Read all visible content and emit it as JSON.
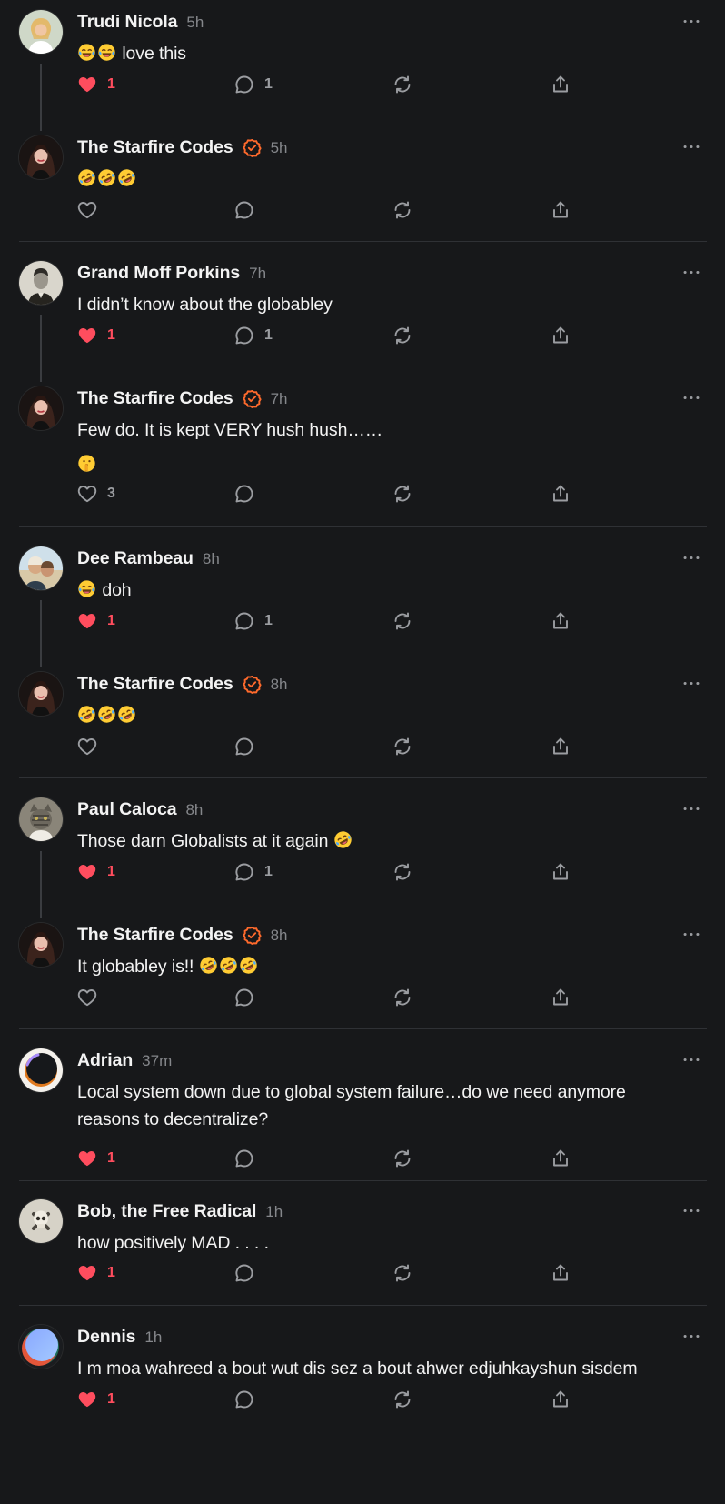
{
  "colors": {
    "background": "#17181a",
    "like_active": "#ff4d5e",
    "verified": "#ff6a2c",
    "muted": "#85878b",
    "icon": "#9b9da1"
  },
  "posts": [
    {
      "author": "Trudi Nicola",
      "time": "5h",
      "verified": false,
      "lines": [
        [
          {
            "emoji": "laughing-tears"
          },
          {
            "emoji": "laughing-tears"
          },
          {
            "t": " love this"
          }
        ]
      ],
      "liked": true,
      "likes": "1",
      "replies": "1",
      "avatar": "avatar-blonde-woman"
    },
    {
      "author": "The Starfire Codes",
      "time": "5h",
      "verified": true,
      "lines": [
        [
          {
            "emoji": "rofl"
          },
          {
            "emoji": "rofl"
          },
          {
            "emoji": "rofl"
          }
        ]
      ],
      "liked": false,
      "likes": "",
      "replies": "",
      "avatar": "avatar-starfire"
    },
    {
      "author": "Grand Moff Porkins",
      "time": "7h",
      "verified": false,
      "lines": [
        [
          {
            "t": "I didn’t know about the globabley"
          }
        ]
      ],
      "liked": true,
      "likes": "1",
      "replies": "1",
      "avatar": "avatar-vintage-portrait"
    },
    {
      "author": "The Starfire Codes",
      "time": "7h",
      "verified": true,
      "lines": [
        [
          {
            "t": "Few do. It is kept VERY hush hush……"
          }
        ],
        [
          {
            "emoji": "shush"
          }
        ]
      ],
      "liked": false,
      "likes": "3",
      "replies": "",
      "avatar": "avatar-starfire"
    },
    {
      "author": "Dee Rambeau",
      "time": "8h",
      "verified": false,
      "lines": [
        [
          {
            "emoji": "laughing-tears"
          },
          {
            "t": " doh"
          }
        ]
      ],
      "liked": true,
      "likes": "1",
      "replies": "1",
      "avatar": "avatar-beach-couple"
    },
    {
      "author": "The Starfire Codes",
      "time": "8h",
      "verified": true,
      "lines": [
        [
          {
            "emoji": "rofl"
          },
          {
            "emoji": "rofl"
          },
          {
            "emoji": "rofl"
          }
        ]
      ],
      "liked": false,
      "likes": "",
      "replies": "",
      "avatar": "avatar-starfire"
    },
    {
      "author": "Paul Caloca",
      "time": "8h",
      "verified": false,
      "lines": [
        [
          {
            "t": "Those darn Globalists at it again "
          },
          {
            "emoji": "rofl"
          }
        ]
      ],
      "liked": true,
      "likes": "1",
      "replies": "1",
      "avatar": "avatar-cat"
    },
    {
      "author": "The Starfire Codes",
      "time": "8h",
      "verified": true,
      "lines": [
        [
          {
            "t": "It globabley is!! "
          },
          {
            "emoji": "rofl"
          },
          {
            "emoji": "rofl"
          },
          {
            "emoji": "rofl"
          }
        ]
      ],
      "liked": false,
      "likes": "",
      "replies": "",
      "avatar": "avatar-starfire"
    },
    {
      "author": "Adrian",
      "time": "37m",
      "verified": false,
      "lines": [
        [
          {
            "t": "Local system down due to global system failure…do we need anymore reasons to decentralize?"
          }
        ]
      ],
      "liked": true,
      "likes": "1",
      "replies": "",
      "avatar": "avatar-eclipse"
    },
    {
      "author": "Bob, the Free Radical",
      "time": "1h",
      "verified": false,
      "lines": [
        [
          {
            "t": "how positively MAD . . . ."
          }
        ]
      ],
      "liked": true,
      "likes": "1",
      "replies": "",
      "avatar": "avatar-skull"
    },
    {
      "author": "Dennis",
      "time": "1h",
      "verified": false,
      "lines": [
        [
          {
            "t": "I m moa wahreed a bout wut dis sez a bout ahwer edjuhkayshun sisdem"
          }
        ]
      ],
      "liked": true,
      "likes": "1",
      "replies": "",
      "avatar": "avatar-gradient"
    }
  ]
}
